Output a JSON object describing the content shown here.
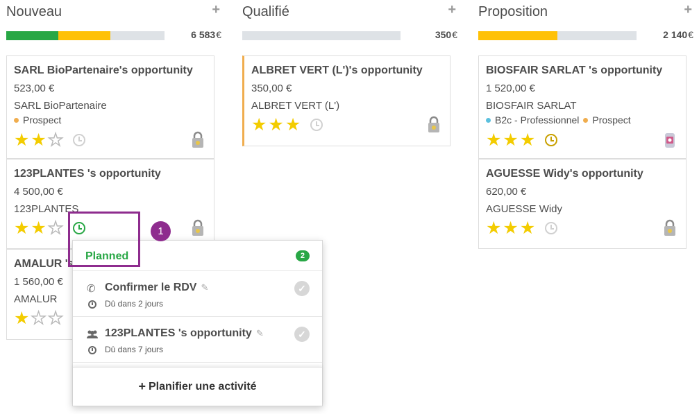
{
  "columns": [
    {
      "title": "Nouveau",
      "total": "6 583",
      "progress": [
        {
          "fraction": 0.33,
          "color": "#28a745"
        },
        {
          "fraction": 0.33,
          "color": "#ffc107"
        }
      ],
      "cards": [
        {
          "title": "SARL BioPartenaire's opportunity",
          "amount": "523,00 €",
          "partner": "SARL BioPartenaire",
          "tags": [
            {
              "label": "Prospect",
              "color": "#f0ad4e"
            }
          ],
          "stars": 2,
          "activity": "grey"
        },
        {
          "title": "123PLANTES 's opportunity",
          "amount": "4 500,00 €",
          "partner": "123PLANTES",
          "tags": [],
          "stars": 2,
          "activity": "green"
        },
        {
          "title": "AMALUR 's opportunity",
          "amount": "1 560,00 €",
          "partner": "AMALUR",
          "tags": [],
          "stars": 1,
          "activity": "grey"
        }
      ]
    },
    {
      "title": "Qualifié",
      "total": "350",
      "progress": [],
      "cards": [
        {
          "title": "ALBRET VERT (L')'s opportunity",
          "amount": "350,00 €",
          "partner": "ALBRET VERT (L')",
          "tags": [],
          "stars": 3,
          "activity": "grey"
        }
      ]
    },
    {
      "title": "Proposition",
      "total": "2 140",
      "progress": [
        {
          "fraction": 0.5,
          "color": "#ffc107"
        }
      ],
      "cards": [
        {
          "title": "BIOSFAIR SARLAT 's opportunity",
          "amount": "1 520,00 €",
          "partner": "BIOSFAIR SARLAT",
          "tags": [
            {
              "label": "B2c - Professionnel",
              "color": "#5bc0de"
            },
            {
              "label": "Prospect",
              "color": "#f0ad4e"
            }
          ],
          "stars": 3,
          "activity": "amber"
        },
        {
          "title": "AGUESSE Widy's opportunity",
          "amount": "620,00 €",
          "partner": "AGUESSE Widy",
          "tags": [],
          "stars": 3,
          "activity": "grey"
        }
      ]
    }
  ],
  "currency": "€",
  "popover": {
    "status": "Planned",
    "count": "2",
    "activities": [
      {
        "icon": "phone-icon",
        "title": "Confirmer le RDV",
        "due": "Dû dans 2 jours"
      },
      {
        "icon": "users-icon",
        "title": "123PLANTES 's opportunity",
        "due": "Dû dans 7 jours"
      }
    ],
    "footer_label": "Planifier une activité"
  },
  "step_badge": "1"
}
